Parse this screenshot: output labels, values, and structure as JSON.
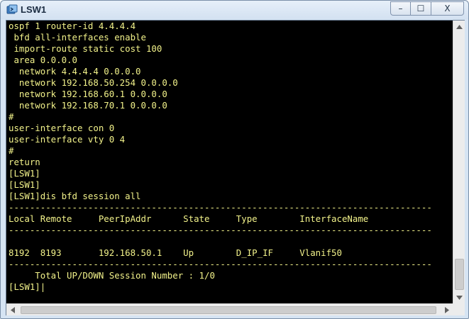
{
  "window": {
    "title": "LSW1",
    "controls": {
      "minimize": "–",
      "maximize": "☐",
      "close": "X"
    }
  },
  "terminal": {
    "lines": [
      "ospf 1 router-id 4.4.4.4",
      " bfd all-interfaces enable",
      " import-route static cost 100",
      " area 0.0.0.0",
      "  network 4.4.4.4 0.0.0.0",
      "  network 192.168.50.254 0.0.0.0",
      "  network 192.168.60.1 0.0.0.0",
      "  network 192.168.70.1 0.0.0.0",
      "#",
      "user-interface con 0",
      "user-interface vty 0 4",
      "#",
      "return",
      "[LSW1]",
      "[LSW1]",
      "[LSW1]dis bfd session all",
      "--------------------------------------------------------------------------------",
      "Local Remote     PeerIpAddr      State     Type        InterfaceName",
      "--------------------------------------------------------------------------------",
      "",
      "8192  8193       192.168.50.1    Up        D_IP_IF     Vlanif50",
      "--------------------------------------------------------------------------------",
      "     Total UP/DOWN Session Number : 1/0",
      "[LSW1]"
    ],
    "cursor": "|"
  },
  "scrollbars": {
    "vertical": {
      "up": "▲",
      "down": "▼"
    },
    "horizontal": {
      "left": "◀",
      "right": "▶"
    }
  }
}
